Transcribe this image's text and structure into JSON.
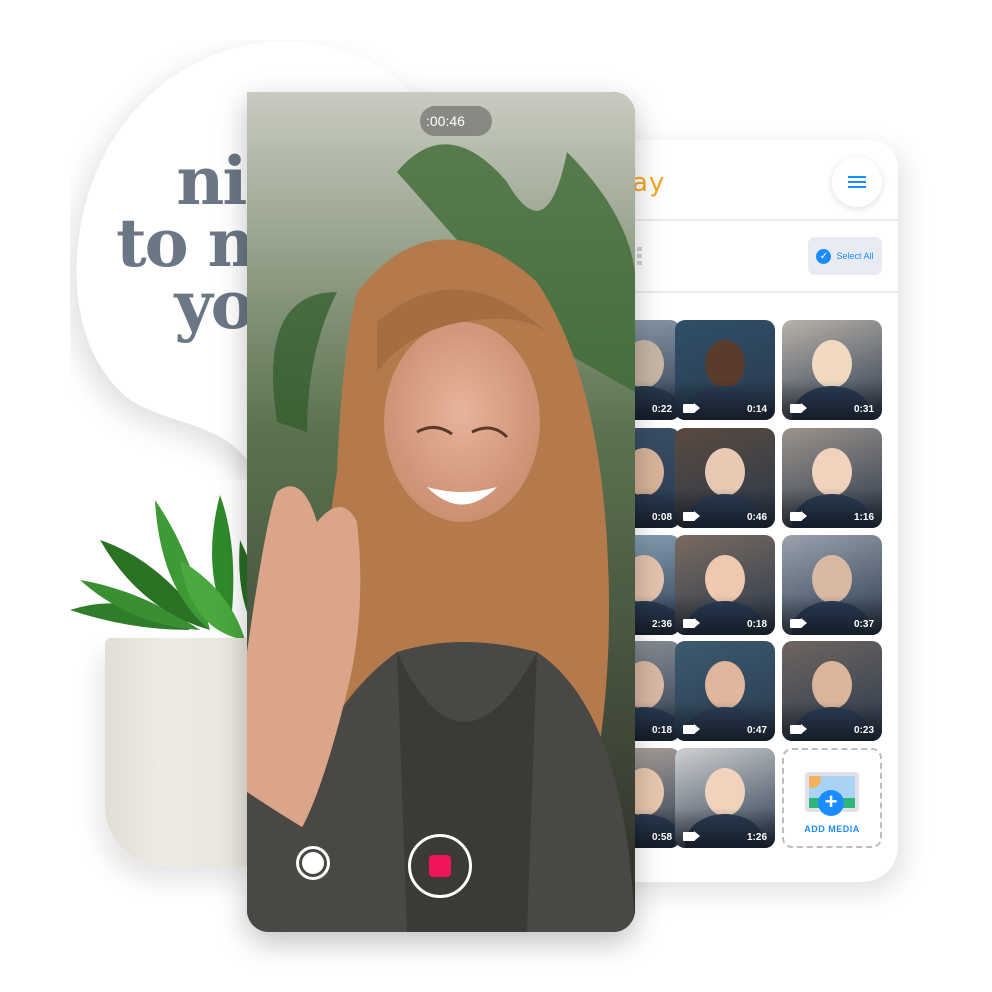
{
  "bubble": {
    "line1": "nice",
    "line2": "to meet",
    "line3": "you!"
  },
  "recorder": {
    "timer": ":00:46",
    "record_color": "#f0145a"
  },
  "app": {
    "logo_fragment": "ay",
    "logo_color": "#f5a623",
    "menu_icon": "hamburger-menu-icon",
    "select_all_label": "Select All",
    "accent_color": "#1a8cff",
    "thumbnails": [
      {
        "duration": "0:22"
      },
      {
        "duration": "0:14"
      },
      {
        "duration": "0:31"
      },
      {
        "duration": "0:08"
      },
      {
        "duration": "0:46"
      },
      {
        "duration": "1:16"
      },
      {
        "duration": "2:36"
      },
      {
        "duration": "0:18"
      },
      {
        "duration": "0:37"
      },
      {
        "duration": "0:18"
      },
      {
        "duration": "0:47"
      },
      {
        "duration": "0:23"
      },
      {
        "duration": "0:58"
      },
      {
        "duration": "1:26"
      }
    ],
    "add_media_label": "ADD MEDIA"
  }
}
